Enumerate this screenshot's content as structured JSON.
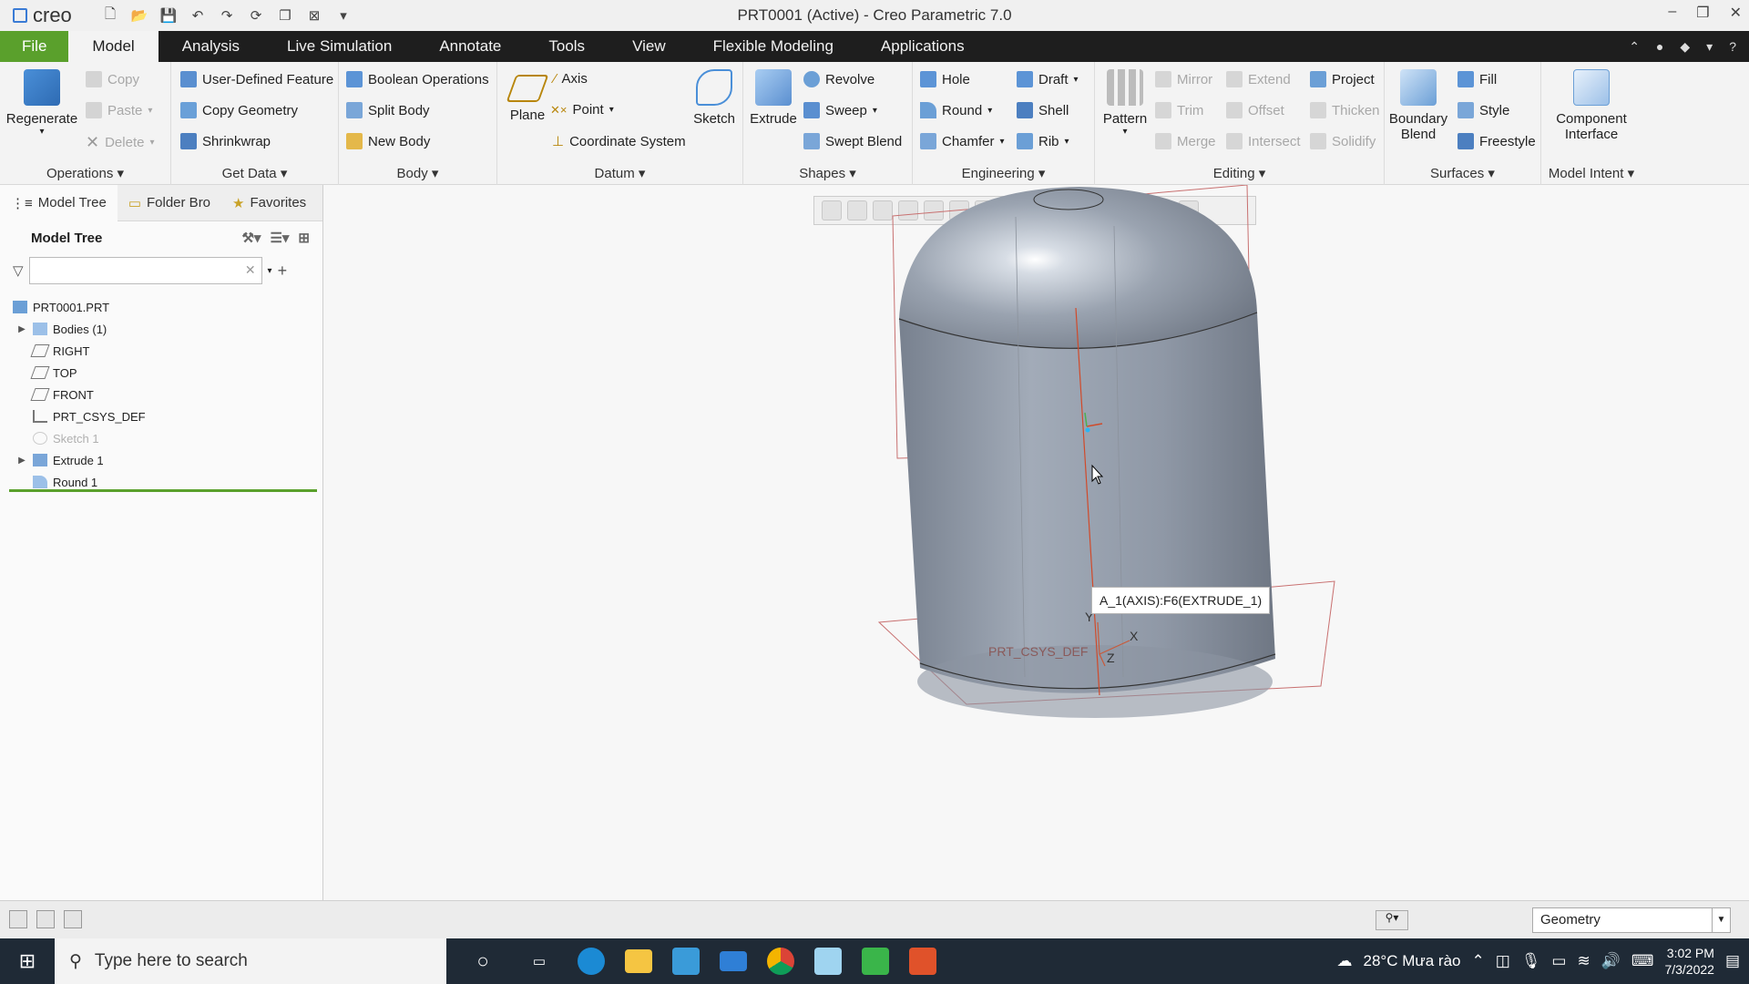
{
  "app": {
    "logo_text": "creo",
    "title": "PRT0001 (Active) - Creo Parametric 7.0",
    "window_controls": [
      "–",
      "❐",
      "✕"
    ]
  },
  "menu": {
    "file": "File",
    "tabs": [
      "Model",
      "Analysis",
      "Live Simulation",
      "Annotate",
      "Tools",
      "View",
      "Flexible Modeling",
      "Applications"
    ],
    "active": "Model"
  },
  "ribbon": {
    "operations": {
      "label": "Operations",
      "regenerate": "Regenerate",
      "copy": "Copy",
      "paste": "Paste",
      "delete": "Delete"
    },
    "get_data": {
      "label": "Get Data",
      "udf": "User-Defined Feature",
      "copy_geometry": "Copy Geometry",
      "shrinkwrap": "Shrinkwrap"
    },
    "body": {
      "label": "Body",
      "boolean": "Boolean Operations",
      "split": "Split Body",
      "new": "New Body"
    },
    "datum": {
      "label": "Datum",
      "plane": "Plane",
      "axis": "Axis",
      "point": "Point",
      "csys": "Coordinate System",
      "sketch": "Sketch"
    },
    "shapes": {
      "label": "Shapes",
      "extrude": "Extrude",
      "revolve": "Revolve",
      "sweep": "Sweep",
      "swept_blend": "Swept Blend"
    },
    "engineering": {
      "label": "Engineering",
      "hole": "Hole",
      "round": "Round",
      "chamfer": "Chamfer",
      "draft": "Draft",
      "shell": "Shell",
      "rib": "Rib"
    },
    "editing": {
      "label": "Editing",
      "pattern": "Pattern",
      "mirror": "Mirror",
      "trim": "Trim",
      "merge": "Merge",
      "extend": "Extend",
      "offset": "Offset",
      "intersect": "Intersect",
      "project": "Project",
      "thicken": "Thicken",
      "solidify": "Solidify"
    },
    "surfaces": {
      "label": "Surfaces",
      "boundary_blend": [
        "Boundary",
        "Blend"
      ],
      "fill": "Fill",
      "style": "Style",
      "freestyle": "Freestyle"
    },
    "model_intent": {
      "label": "Model Intent",
      "component_interface": [
        "Component",
        "Interface"
      ]
    }
  },
  "left_panel": {
    "tabs": [
      "Model Tree",
      "Folder Bro",
      "Favorites"
    ],
    "tree_title": "Model Tree",
    "filter_placeholder": "",
    "nodes": [
      {
        "label": "PRT0001.PRT"
      },
      {
        "label": "Bodies (1)"
      },
      {
        "label": "RIGHT"
      },
      {
        "label": "TOP"
      },
      {
        "label": "FRONT"
      },
      {
        "label": "PRT_CSYS_DEF"
      },
      {
        "label": "Sketch 1"
      },
      {
        "label": "Extrude 1"
      },
      {
        "label": "Round 1"
      }
    ]
  },
  "graphics": {
    "tooltip": "A_1(AXIS):F6(EXTRUDE_1)",
    "csys_label": "PRT_CSYS_DEF",
    "axis_x": "X",
    "axis_y": "Y",
    "axis_z": "Z"
  },
  "status": {
    "selection_filter": "Geometry"
  },
  "taskbar": {
    "search_placeholder": "Type here to search",
    "weather": "28°C  Mưa rào",
    "time": "3:02 PM",
    "date": "7/3/2022"
  },
  "colors": {
    "file_tab": "#5aa02c",
    "menubar": "#1e1e1e",
    "model_body": "#8d96a5",
    "taskbar": "#1f2a36"
  }
}
